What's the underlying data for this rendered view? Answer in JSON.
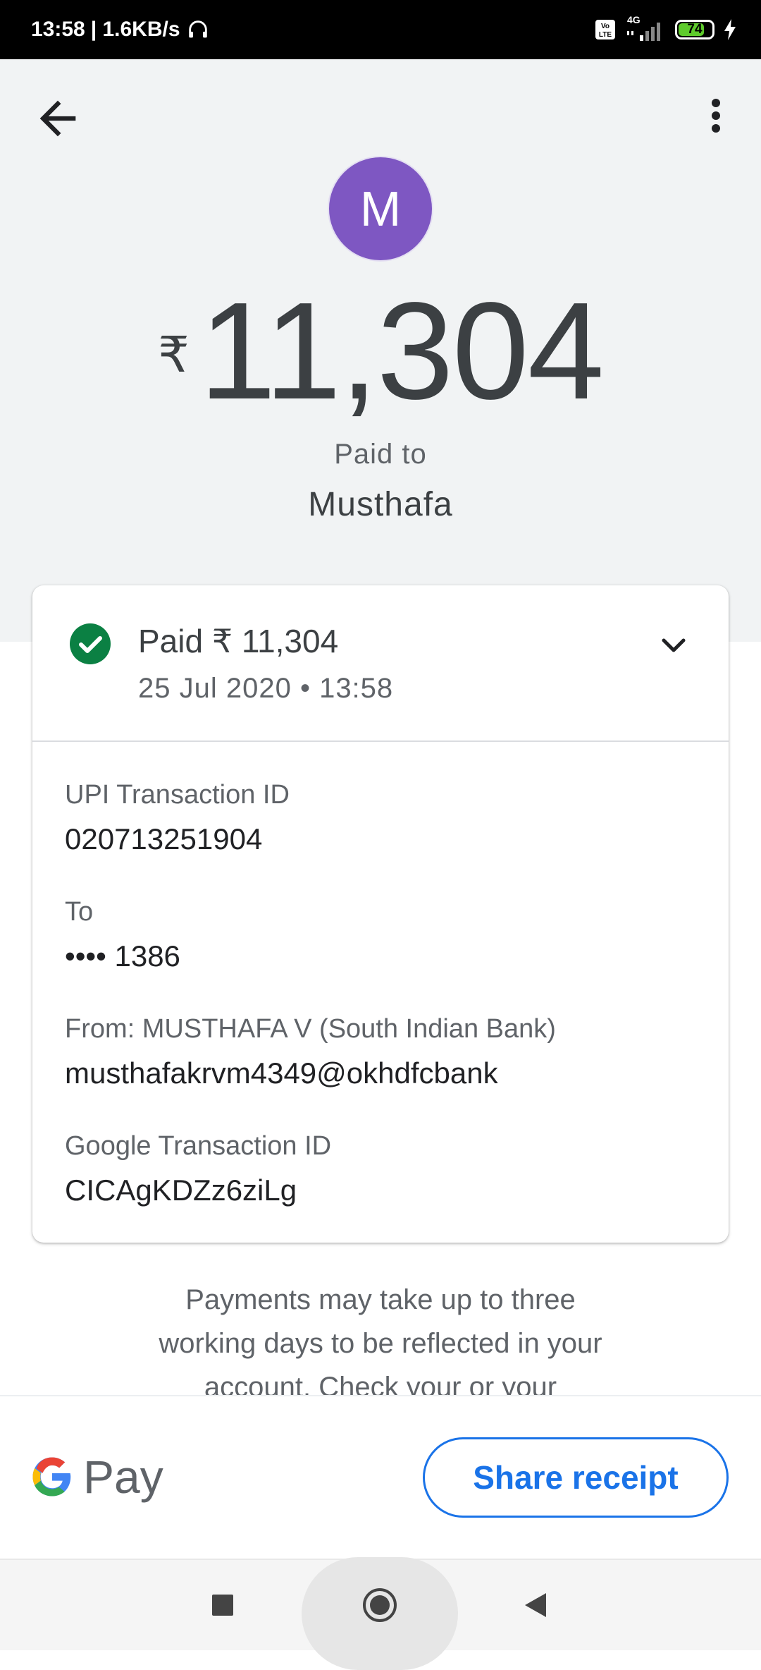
{
  "status_bar": {
    "time": "13:58",
    "speed": "| 1.6KB/s",
    "network": "4G",
    "battery_level": "74",
    "icons": [
      "headphones-icon",
      "volte-icon",
      "signal-icon",
      "battery-icon",
      "charging-icon"
    ]
  },
  "header": {
    "back_icon": "arrow-left-icon",
    "menu_icon": "more-vert-icon",
    "avatar_letter": "M",
    "avatar_color": "#7e57c2",
    "currency_symbol": "₹",
    "amount": "11,304",
    "paid_to_label": "Paid to",
    "payee_name": "Musthafa"
  },
  "card": {
    "status_icon": "check-circle-icon",
    "status_color": "#0b8043",
    "paid_line": "Paid ₹ 11,304",
    "date_time": "25 Jul 2020 • 13:58",
    "expand_icon": "chevron-down-icon",
    "fields": [
      {
        "label": "UPI Transaction ID",
        "value": "020713251904"
      },
      {
        "label": "To",
        "value": "•••• 1386"
      },
      {
        "label": "From: MUSTHAFA V (South Indian Bank)",
        "value": "musthafakrvm4349@okhdfcbank"
      },
      {
        "label": "Google Transaction ID",
        "value": "CICAgKDZz6ziLg"
      }
    ]
  },
  "info": {
    "text": "Payments may take up to three working days to be reflected in your account. Check your or your"
  },
  "footer": {
    "logo_text": "Pay",
    "share_label": "Share receipt",
    "accent_color": "#1a73e8"
  },
  "nav": {
    "icons": [
      "recents-square-icon",
      "home-circle-icon",
      "back-triangle-icon"
    ]
  }
}
